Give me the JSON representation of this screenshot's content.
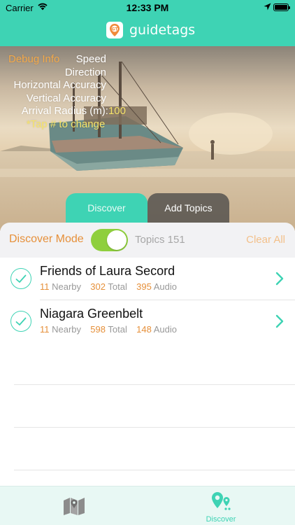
{
  "status_bar": {
    "carrier": "Carrier",
    "time": "12:33 PM",
    "battery_level": 1.0
  },
  "header": {
    "app_name": "guidetags",
    "logo_icon": "gt-pin-logo-icon",
    "accent_color": "#3ed3b4"
  },
  "debug": {
    "title": "Debug Info",
    "speed_label": "Speed",
    "direction_label": "Direction",
    "horizontal_accuracy_label": "Horizontal Accuracy",
    "vertical_accuracy_label": "Vertical Accuracy",
    "arrival_radius_label": "Arrival Radius (m):",
    "arrival_radius_value": "100",
    "hint": "*Tap # to change"
  },
  "segments": {
    "discover_label": "Discover",
    "add_topics_label": "Add Topics",
    "selected": "Discover"
  },
  "mode_bar": {
    "label": "Discover Mode",
    "toggle_on": true,
    "topics_text": "Topics 151",
    "clear_label": "Clear All"
  },
  "topics": [
    {
      "title": "Friends of Laura Secord",
      "nearby": "11",
      "nearby_label": "Nearby",
      "total": "302",
      "total_label": "Total",
      "audio": "395",
      "audio_label": "Audio",
      "checked": true
    },
    {
      "title": "Niagara Greenbelt",
      "nearby": "11",
      "nearby_label": "Nearby",
      "total": "598",
      "total_label": "Total",
      "audio": "148",
      "audio_label": "Audio",
      "checked": true
    }
  ],
  "tabbar": {
    "map_icon": "map-icon",
    "discover_icon": "discover-pins-icon",
    "discover_label": "Discover",
    "selected": "Discover"
  },
  "colors": {
    "accent": "#3ed3b4",
    "orange": "#e6903a",
    "toggle_green": "#8fcf3d"
  }
}
